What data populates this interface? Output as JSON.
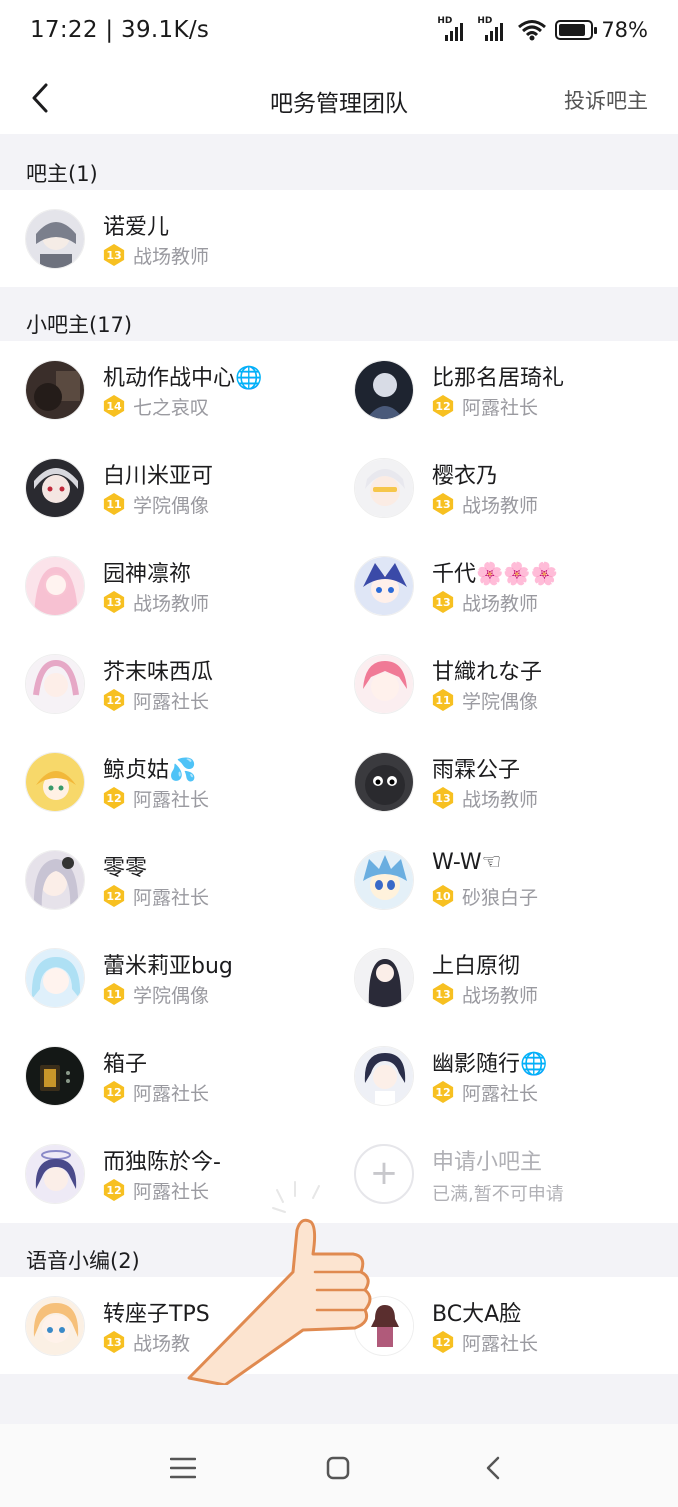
{
  "status": {
    "time": "17:22 | 39.1K/s",
    "battery": "78%"
  },
  "nav": {
    "title": "吧务管理团队",
    "action": "投诉吧主"
  },
  "sections": {
    "owner": {
      "title": "吧主(1)"
    },
    "sub": {
      "title": "小吧主(17)"
    },
    "voice": {
      "title": "语音小编(2)"
    }
  },
  "owner": [
    {
      "name": "诺爱儿",
      "level": "13",
      "title": "战场教师"
    }
  ],
  "sub_owners": [
    {
      "name": "机动作战中心🌐",
      "level": "14",
      "title": "七之哀叹"
    },
    {
      "name": "比那名居琦礼",
      "level": "12",
      "title": "阿露社长"
    },
    {
      "name": "白川米亚可",
      "level": "11",
      "title": "学院偶像"
    },
    {
      "name": "樱衣乃",
      "level": "13",
      "title": "战场教师"
    },
    {
      "name": "园神凛祢",
      "level": "13",
      "title": "战场教师"
    },
    {
      "name": "千代🌸🌸🌸",
      "level": "13",
      "title": "战场教师"
    },
    {
      "name": "芥末味西瓜",
      "level": "12",
      "title": "阿露社长"
    },
    {
      "name": " 甘織れな子",
      "level": "11",
      "title": "学院偶像"
    },
    {
      "name": "鲸贞姑💦",
      "level": "12",
      "title": "阿露社长"
    },
    {
      "name": "雨霖公子",
      "level": "13",
      "title": "战场教师"
    },
    {
      "name": "零零",
      "level": "12",
      "title": "阿露社长"
    },
    {
      "name": "W-W☜",
      "level": "10",
      "title": "砂狼白子"
    },
    {
      "name": "蕾米莉亚bug",
      "level": "11",
      "title": "学院偶像"
    },
    {
      "name": "上白原彻",
      "level": "13",
      "title": "战场教师"
    },
    {
      "name": "箱子",
      "level": "12",
      "title": "阿露社长"
    },
    {
      "name": "幽影随行🌐",
      "level": "12",
      "title": "阿露社长"
    },
    {
      "name": "而独陈於今-",
      "level": "12",
      "title": "阿露社长"
    }
  ],
  "apply": {
    "label": "申请小吧主",
    "sub": "已满,暂不可申请"
  },
  "voice_editors": [
    {
      "name": "转座子TPS",
      "level": "13",
      "title": "战场教"
    },
    {
      "name": "BC大A脸",
      "level": "12",
      "title": "阿露社长"
    }
  ],
  "colors": {
    "level_badge": "#f7c021",
    "section_bg": "#f3f3f7",
    "muted_text": "#9a9aa0"
  },
  "icons": {
    "back": "chevron-left-icon",
    "menu": "menu-icon",
    "home": "home-square-icon",
    "nav_back": "nav-back-icon",
    "apply": "plus-icon"
  }
}
